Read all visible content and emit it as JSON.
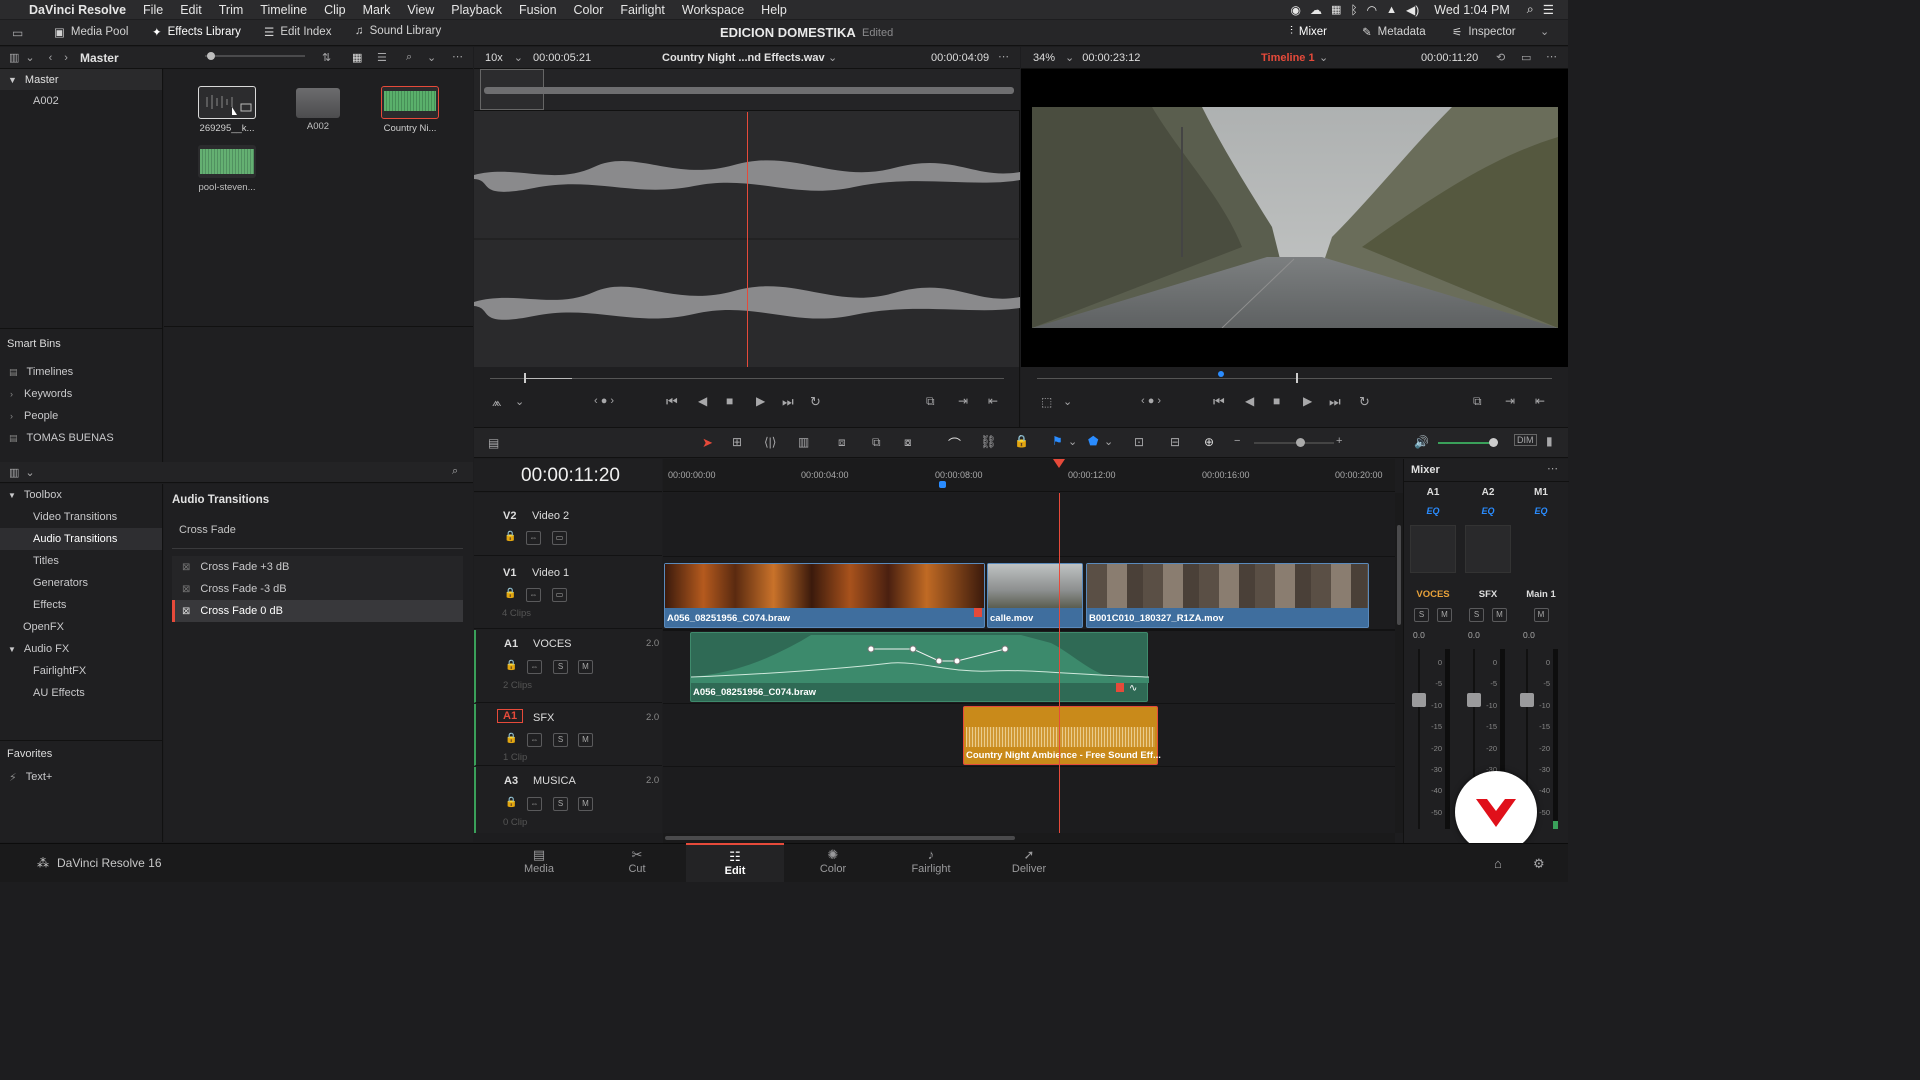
{
  "menubar": {
    "app": "DaVinci Resolve",
    "items": [
      "File",
      "Edit",
      "Trim",
      "Timeline",
      "Clip",
      "Mark",
      "View",
      "Playback",
      "Fusion",
      "Color",
      "Fairlight",
      "Workspace",
      "Help"
    ],
    "clock": "Wed 1:04 PM"
  },
  "toolbar": {
    "media_pool": "Media Pool",
    "effects_library": "Effects Library",
    "edit_index": "Edit Index",
    "sound_library": "Sound Library",
    "project_title": "EDICION DOMESTIKA",
    "project_status": "Edited",
    "mixer": "Mixer",
    "metadata": "Metadata",
    "inspector": "Inspector"
  },
  "media_pool": {
    "header": "Master",
    "bins_root": "Master",
    "bins": [
      "A002"
    ],
    "clips": [
      {
        "label": "269295__k...",
        "kind": "audio-selected"
      },
      {
        "label": "A002",
        "kind": "folder"
      },
      {
        "label": "Country Ni...",
        "kind": "audio-green"
      },
      {
        "label": "pool-steven...",
        "kind": "audio-green"
      }
    ]
  },
  "smart_bins": {
    "title": "Smart Bins",
    "items": [
      "Timelines",
      "Keywords",
      "People",
      "TOMAS BUENAS"
    ]
  },
  "effects": {
    "toolbox": "Toolbox",
    "toolbox_items": [
      "Video Transitions",
      "Audio Transitions",
      "Titles",
      "Generators",
      "Effects"
    ],
    "openfx": "OpenFX",
    "audio_fx": "Audio FX",
    "audio_fx_items": [
      "FairlightFX",
      "AU Effects"
    ],
    "favorites": "Favorites",
    "favorite_items": [
      "Text+"
    ],
    "panel_title": "Audio Transitions",
    "group": "Cross Fade",
    "transitions": [
      "Cross Fade +3 dB",
      "Cross Fade -3 dB",
      "Cross Fade 0 dB"
    ],
    "selected_index": 2
  },
  "source_viewer": {
    "zoom": "10x",
    "timecode_left": "00:00:05:21",
    "clip_name": "Country Night ...nd Effects.wav",
    "timecode_right": "00:00:04:09"
  },
  "timeline_viewer": {
    "zoom": "34%",
    "timecode_left": "00:00:23:12",
    "timeline_name": "Timeline 1",
    "timecode_right": "00:00:11:20"
  },
  "timeline": {
    "timecode": "00:00:11:20",
    "ruler": [
      "00:00:00:00",
      "00:00:04:00",
      "00:00:08:00",
      "00:00:12:00",
      "00:00:16:00",
      "00:00:20:00"
    ],
    "tracks": {
      "v2": {
        "id": "V2",
        "name": "Video 2"
      },
      "v1": {
        "id": "V1",
        "name": "Video 1",
        "count": "4 Clips"
      },
      "a1": {
        "id": "A1",
        "name": "VOCES",
        "level": "2.0",
        "count": "2 Clips"
      },
      "a2": {
        "id": "A1",
        "name": "SFX",
        "level": "2.0",
        "count": "1 Clip"
      },
      "a3": {
        "id": "A3",
        "name": "MUSICA",
        "level": "2.0",
        "count": "0 Clip"
      }
    },
    "clips": {
      "v1a": "A056_08251956_C074.braw",
      "v1b": "calle.mov",
      "v1c": "B001C010_180327_R1ZA.mov",
      "a1": "A056_08251956_C074.braw",
      "sfx": "Country Night Ambience - Free Sound Eff..."
    }
  },
  "mixer": {
    "title": "Mixer",
    "channels": [
      {
        "id": "A1",
        "eq": "EQ",
        "name": "VOCES",
        "value": "0.0"
      },
      {
        "id": "A2",
        "eq": "EQ",
        "name": "SFX",
        "value": "0.0"
      },
      {
        "id": "M1",
        "eq": "EQ",
        "name": "Main 1",
        "value": "0.0"
      }
    ],
    "scale": [
      "0",
      "-5",
      "-10",
      "-15",
      "-20",
      "-30",
      "-40",
      "-50"
    ]
  },
  "footer": {
    "app_version": "DaVinci Resolve 16",
    "pages": [
      "Media",
      "Cut",
      "Edit",
      "Color",
      "Fairlight",
      "Deliver"
    ],
    "active_page": "Edit"
  },
  "colors": {
    "accent_red": "#e64a3a",
    "video_clip_blue": "#3f6e9e",
    "audio_green": "#2f6a55",
    "sfx_orange": "#c98a1a"
  }
}
